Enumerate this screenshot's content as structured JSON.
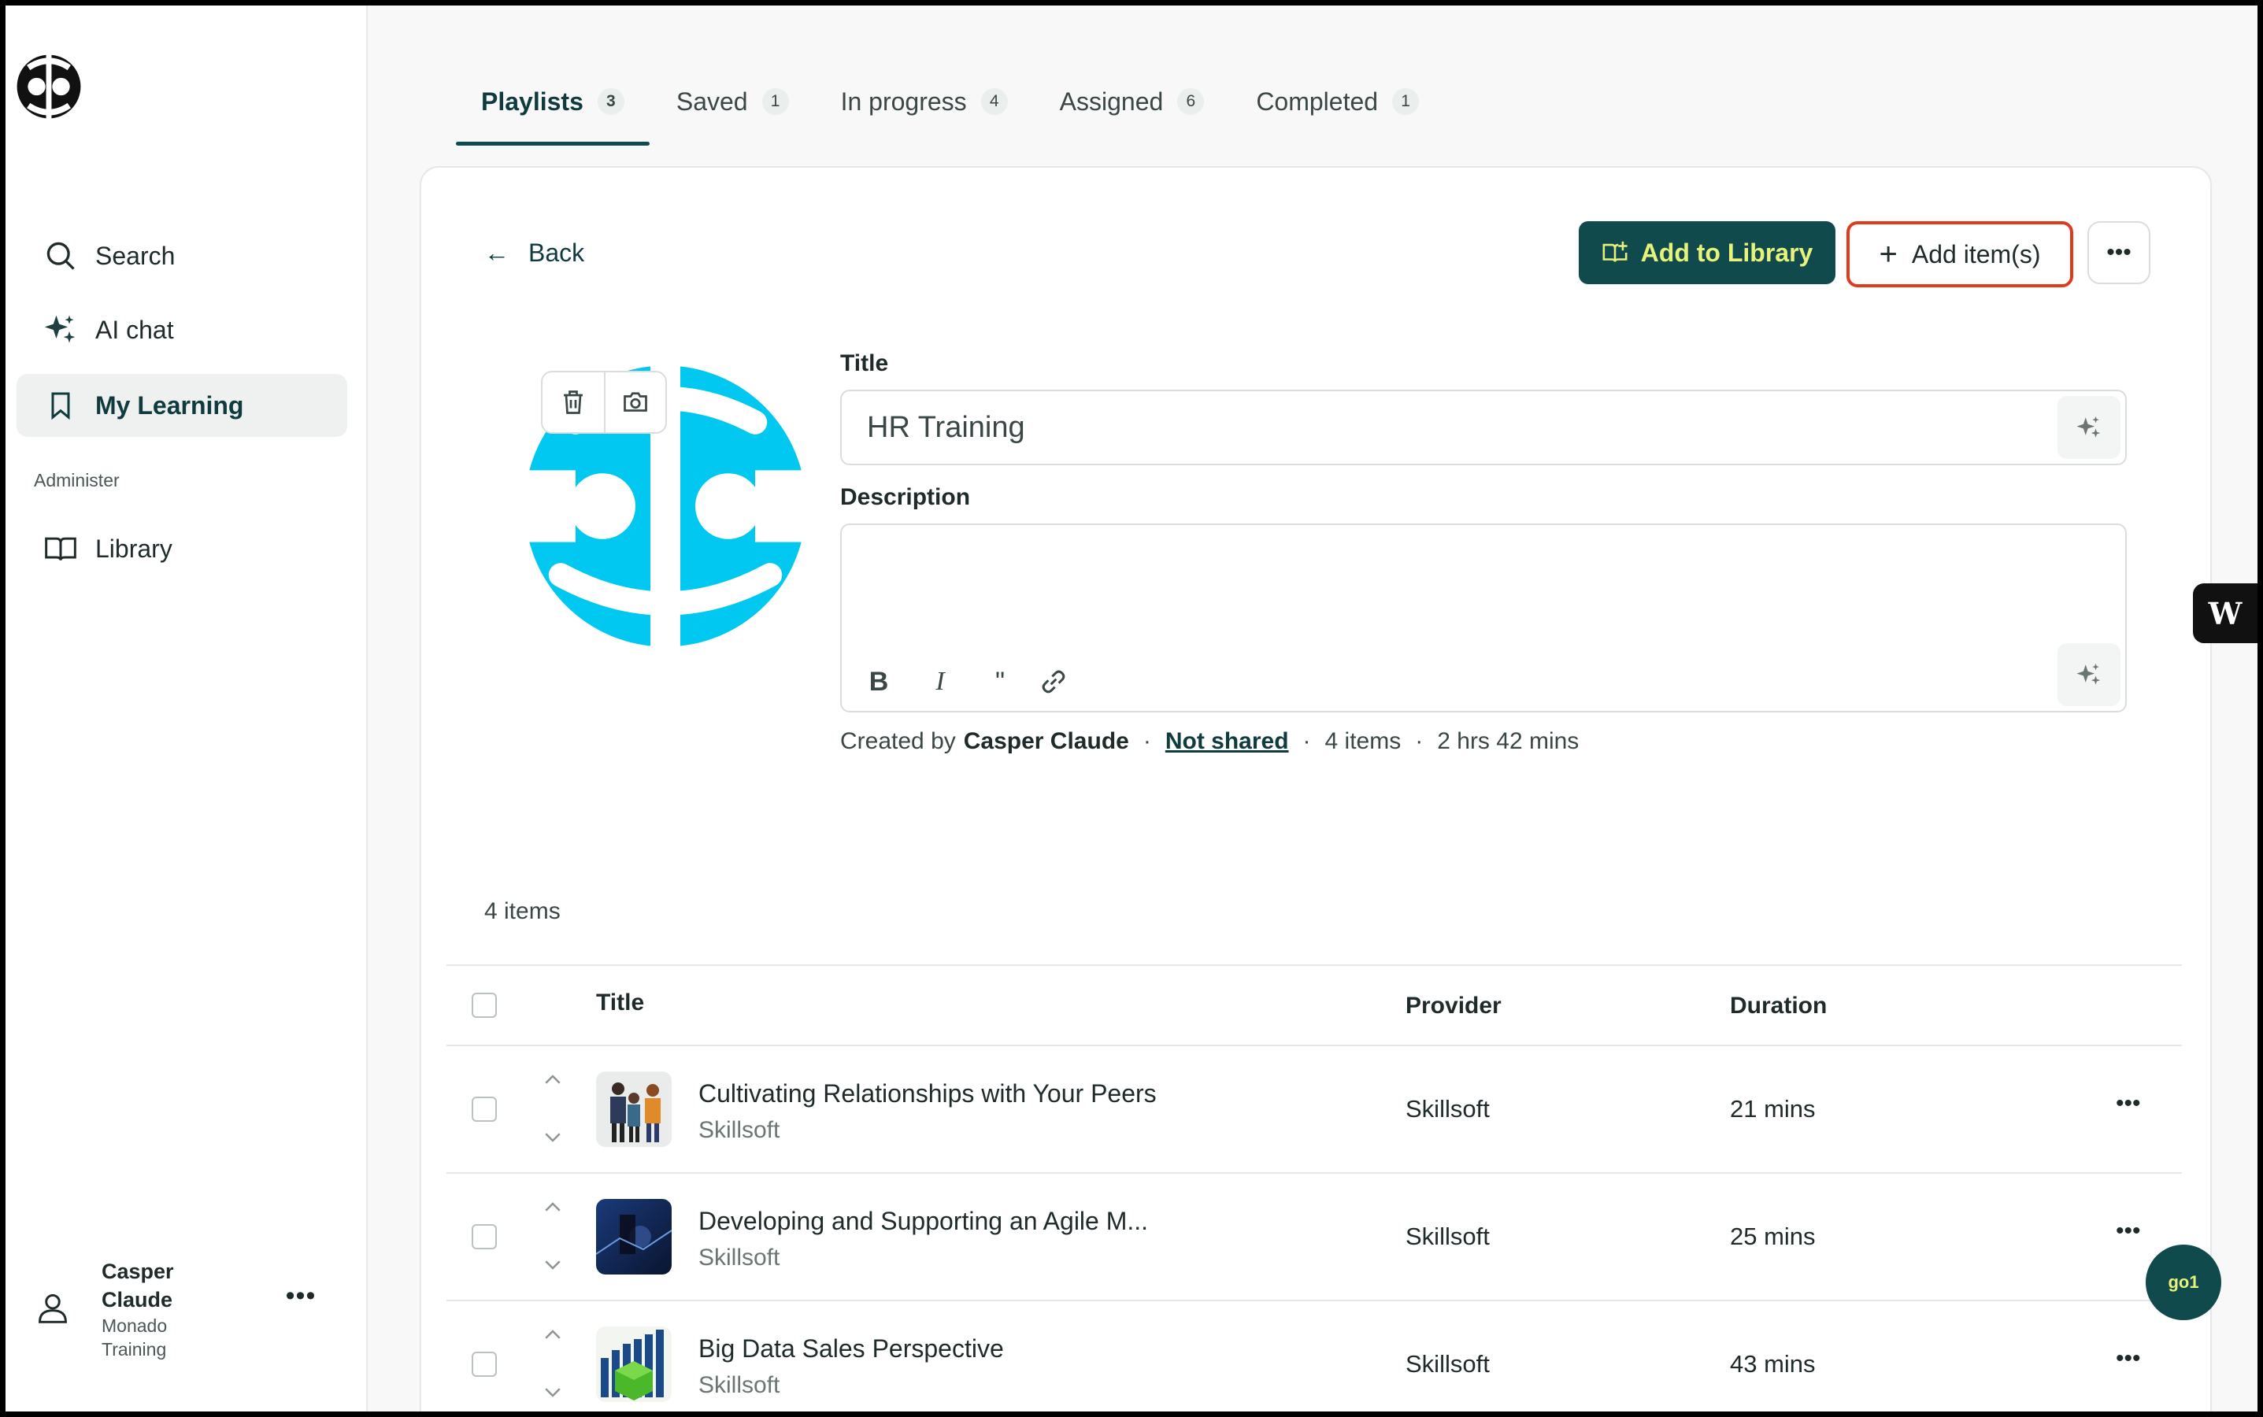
{
  "sidebar": {
    "nav": [
      {
        "label": "Search",
        "icon": "search-icon"
      },
      {
        "label": "AI chat",
        "icon": "sparkle-icon"
      },
      {
        "label": "My Learning",
        "icon": "bookmark-icon"
      }
    ],
    "admin_label": "Administer",
    "admin_nav": [
      {
        "label": "Library",
        "icon": "book-open-icon"
      }
    ],
    "user": {
      "name": "Casper Claude",
      "org": "Monado Training"
    }
  },
  "tabs": [
    {
      "label": "Playlists",
      "count": "3"
    },
    {
      "label": "Saved",
      "count": "1"
    },
    {
      "label": "In progress",
      "count": "4"
    },
    {
      "label": "Assigned",
      "count": "6"
    },
    {
      "label": "Completed",
      "count": "1"
    }
  ],
  "toolbar": {
    "back": "Back",
    "add_to_library": "Add to Library",
    "add_items": "Add item(s)"
  },
  "form": {
    "title_label": "Title",
    "title_value": "HR Training",
    "description_label": "Description",
    "description_value": ""
  },
  "meta": {
    "created_by_prefix": "Created by",
    "creator": "Casper Claude",
    "sharing": "Not shared",
    "items": "4 items",
    "duration": "2 hrs 42 mins"
  },
  "list": {
    "count_label": "4 items",
    "columns": {
      "title": "Title",
      "provider": "Provider",
      "duration": "Duration"
    },
    "rows": [
      {
        "title": "Cultivating Relationships with Your Peers",
        "source": "Skillsoft",
        "provider": "Skillsoft",
        "duration": "21 mins"
      },
      {
        "title": "Developing and Supporting an Agile M...",
        "source": "Skillsoft",
        "provider": "Skillsoft",
        "duration": "25 mins"
      },
      {
        "title": "Big Data Sales Perspective",
        "source": "Skillsoft",
        "provider": "Skillsoft",
        "duration": "43 mins"
      }
    ]
  },
  "widgets": {
    "chat_fab": "go1"
  },
  "colors": {
    "accent": "#104a4d",
    "accent_text": "#e7f27a",
    "highlight": "#e03a1e",
    "cover": "#00c8f0"
  }
}
